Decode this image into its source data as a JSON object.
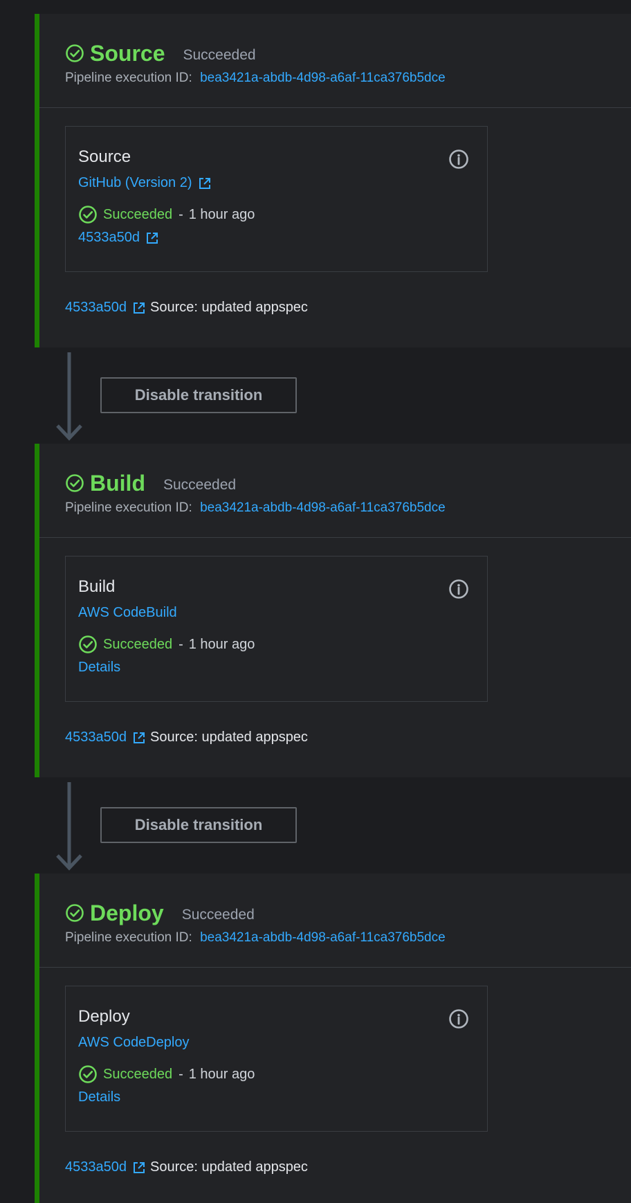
{
  "colors": {
    "success": "#6edb5b",
    "link": "#33aaff",
    "stage_bar": "#1d8102"
  },
  "stages": [
    {
      "name": "Source",
      "status": "Succeeded",
      "exec_label": "Pipeline execution ID:",
      "exec_id": "bea3421a-abdb-4d98-a6af-11ca376b5dce",
      "action": {
        "name": "Source",
        "provider": "GitHub (Version 2)",
        "status": "Succeeded",
        "sep": "-",
        "time": "1 hour ago",
        "link": "4533a50d"
      },
      "commit": {
        "id": "4533a50d",
        "message": "Source: updated appspec"
      }
    },
    {
      "name": "Build",
      "status": "Succeeded",
      "exec_label": "Pipeline execution ID:",
      "exec_id": "bea3421a-abdb-4d98-a6af-11ca376b5dce",
      "action": {
        "name": "Build",
        "provider": "AWS CodeBuild",
        "status": "Succeeded",
        "sep": "-",
        "time": "1 hour ago",
        "link": "Details"
      },
      "commit": {
        "id": "4533a50d",
        "message": "Source: updated appspec"
      }
    },
    {
      "name": "Deploy",
      "status": "Succeeded",
      "exec_label": "Pipeline execution ID:",
      "exec_id": "bea3421a-abdb-4d98-a6af-11ca376b5dce",
      "action": {
        "name": "Deploy",
        "provider": "AWS CodeDeploy",
        "status": "Succeeded",
        "sep": "-",
        "time": "1 hour ago",
        "link": "Details"
      },
      "commit": {
        "id": "4533a50d",
        "message": "Source: updated appspec"
      }
    }
  ],
  "transitions": [
    {
      "button_label": "Disable transition"
    },
    {
      "button_label": "Disable transition"
    }
  ]
}
